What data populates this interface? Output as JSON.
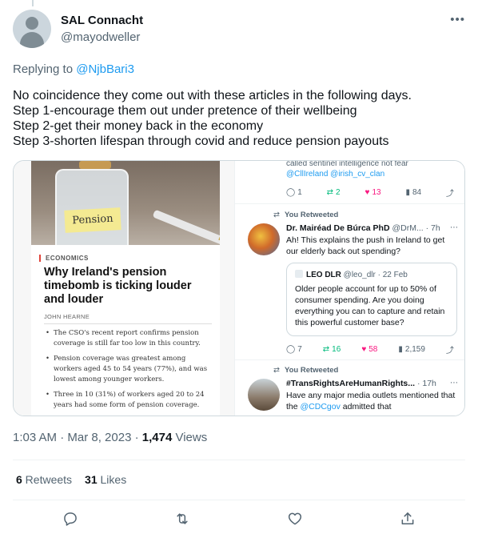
{
  "author": {
    "name": "SAL Connacht",
    "handle": "@mayodweller"
  },
  "replying_to": {
    "prefix": "Replying to ",
    "handle": "@NjbBari3"
  },
  "tweet_lines": [
    "No coincidence they come out with these articles in the following days.",
    "Step 1-encourage them out under pretence of their wellbeing",
    "Step 2-get their money back in the economy",
    "Step 3-shorten lifespan through covid and reduce pension payouts"
  ],
  "media": {
    "article": {
      "jar_label": "Pension",
      "tag": "ECONOMICS",
      "headline": "Why Ireland's pension timebomb is ticking louder and louder",
      "author": "JOHN HEARNE",
      "bullets": [
        "The CSO's recent report confirms pension coverage is still far too low in this country.",
        "Pension coverage was greatest among workers aged 45 to 54 years (77%), and was lowest among younger workers.",
        "Three in 10 (31%) of workers aged 20 to 24 years had some form of pension coverage."
      ]
    },
    "feed": {
      "top_text": "called sentinel intelligence not fear",
      "top_links": "@CllIreland @irish_cv_clan",
      "top_actions": {
        "replies": "1",
        "retweets": "2",
        "likes": "13",
        "views": "84"
      },
      "post1": {
        "retweet_label": "You Retweeted",
        "name": "Dr. Mairéad De Búrca PhD",
        "handle_time": "@DrM... · 7h",
        "text": "Ah! This explains the push in Ireland to get our elderly back out spending?",
        "quote": {
          "name": "LEO DLR",
          "handle_time": "@leo_dlr · 22 Feb",
          "text": "Older people account for up to 50% of consumer spending. Are you doing everything you can to capture and retain this powerful customer base?"
        },
        "actions": {
          "replies": "7",
          "retweets": "16",
          "likes": "58",
          "views": "2,159"
        }
      },
      "post2": {
        "retweet_label": "You Retweeted",
        "name": "#TransRightsAreHumanRights...",
        "handle_time": "· 17h",
        "text_before": "Have any major media outlets mentioned that the ",
        "text_link": "@CDCgov",
        "text_after": " admitted that"
      }
    }
  },
  "meta": {
    "time_date": "1:03 AM · Mar 8, 2023 · ",
    "views_count": "1,474",
    "views_label": " Views"
  },
  "stats": {
    "retweets_count": "6",
    "retweets_label": " Retweets",
    "likes_count": "31",
    "likes_label": " Likes"
  },
  "icons": {
    "more": "more-dots-icon",
    "reply": "reply-icon",
    "retweet": "retweet-icon",
    "like": "heart-icon",
    "share": "share-icon"
  },
  "colors": {
    "link": "#1d9bf0",
    "secondary_text": "#536471",
    "retweet_green": "#00ba7c",
    "like_pink": "#f91880"
  }
}
